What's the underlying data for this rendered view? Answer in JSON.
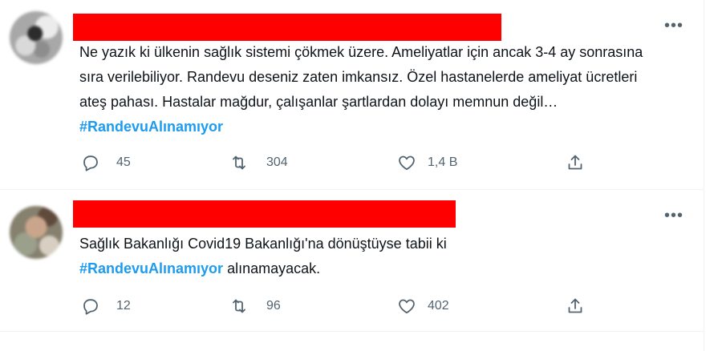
{
  "colors": {
    "redaction": "#ff0000",
    "hashtag": "#1d9bf0",
    "muted": "#536471",
    "divider": "#eff3f4"
  },
  "tweets": [
    {
      "more_icon": "more-horizontal-icon",
      "text_before": "Ne yazık ki ülkenin sağlık sistemi çökmek üzere. Ameliyatlar için ancak 3-4 ay sonrasına sıra verilebiliyor. Randevu deseniz zaten imkansız. Özel hastanelerde ameliyat ücretleri ateş pahası. Hastalar mağdur, çalışanlar şartlardan dolayı memnun değil… ",
      "hashtag": "#RandevuAlınamıyor",
      "text_after": "",
      "replies": "45",
      "retweets": "304",
      "likes": "1,4 B",
      "icons": [
        "reply-icon",
        "retweet-icon",
        "like-icon",
        "share-icon"
      ]
    },
    {
      "more_icon": "more-horizontal-icon",
      "text_before": "Sağlık Bakanlığı Covid19 Bakanlığı'na dönüştüyse tabii ki ",
      "hashtag": "#RandevuAlınamıyor",
      "text_after": " alınamayacak.",
      "replies": "12",
      "retweets": "96",
      "likes": "402",
      "icons": [
        "reply-icon",
        "retweet-icon",
        "like-icon",
        "share-icon"
      ]
    }
  ]
}
